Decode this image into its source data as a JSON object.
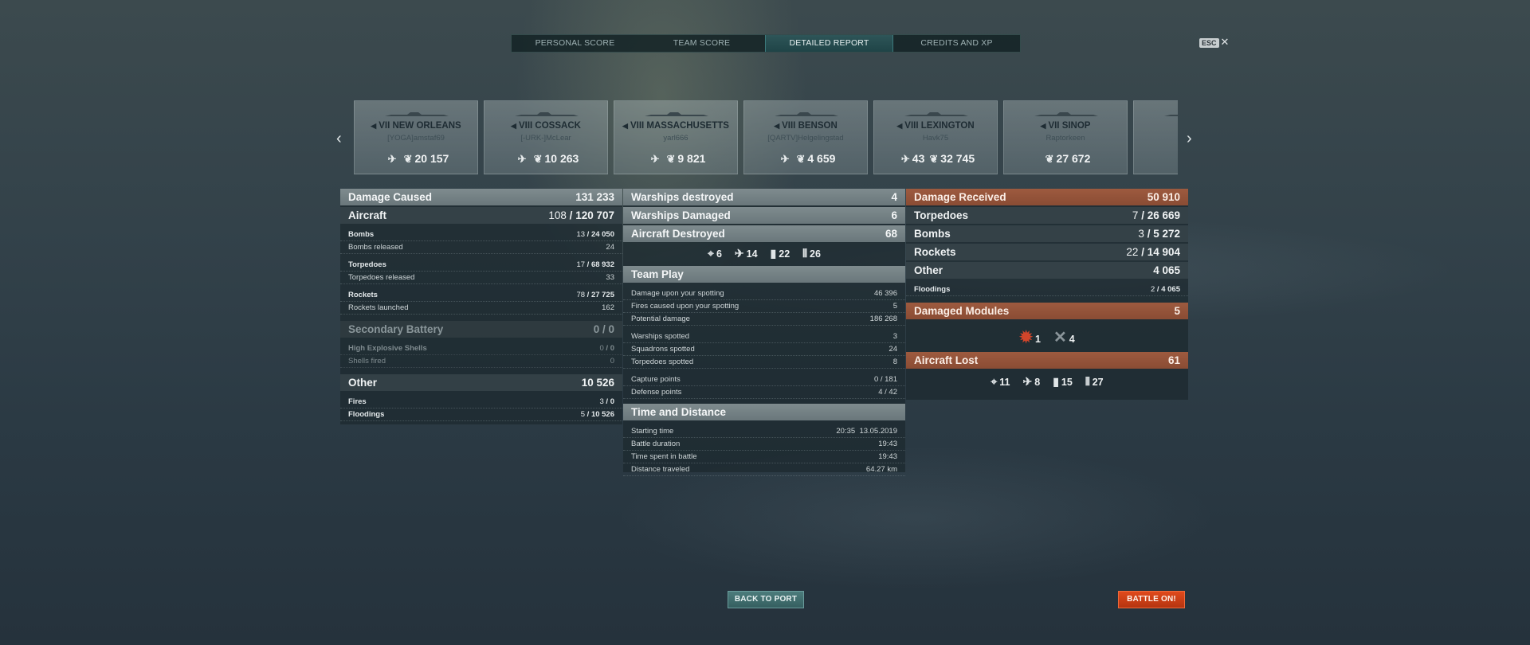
{
  "tabs": [
    "PERSONAL SCORE",
    "TEAM SCORE",
    "DETAILED REPORT",
    "CREDITS AND XP"
  ],
  "active_tab": "DETAILED REPORT",
  "esc": {
    "key": "ESC",
    "close": "✕"
  },
  "nav": {
    "prev": "‹",
    "next": "›"
  },
  "ships": [
    {
      "tier_name": "VII NEW ORLEANS",
      "player": "[YOGA]amstaf69",
      "icons": [
        "plane-icon",
        "laurel-icon"
      ],
      "values": [
        "",
        "20 157"
      ]
    },
    {
      "tier_name": "VIII COSSACK",
      "player": "[-URK-]McLear",
      "icons": [
        "plane-icon",
        "laurel-icon"
      ],
      "values": [
        "",
        "10 263"
      ]
    },
    {
      "tier_name": "VIII MASSACHUSETTS",
      "player": "yarl666",
      "icons": [
        "plane-icon",
        "laurel-icon"
      ],
      "values": [
        "",
        "9 821"
      ]
    },
    {
      "tier_name": "VIII BENSON",
      "player": "[QARTV]Helgelingstad",
      "icons": [
        "plane-icon",
        "laurel-icon"
      ],
      "values": [
        "",
        "4 659"
      ]
    },
    {
      "tier_name": "VIII LEXINGTON",
      "player": "Havk75",
      "icons": [
        "crossed-plane-icon",
        "laurel-icon"
      ],
      "values": [
        "43",
        "32 745"
      ]
    },
    {
      "tier_name": "VII SINOP",
      "player": "Raptorkeen",
      "icons": [
        "laurel-icon"
      ],
      "values": [
        "27 672"
      ]
    },
    {
      "tier_name": "V",
      "player": "[BA",
      "icons": [],
      "values": []
    }
  ],
  "damage_caused": {
    "header": {
      "label": "Damage Caused",
      "value": "131 233"
    },
    "aircraft": {
      "label": "Aircraft",
      "value_a": "108",
      "value_b": "120 707"
    },
    "bombs": {
      "label": "Bombs",
      "value_a": "13",
      "value_b": "24 050"
    },
    "bombs_released": {
      "label": "Bombs released",
      "value": "24"
    },
    "torpedoes": {
      "label": "Torpedoes",
      "value_a": "17",
      "value_b": "68 932"
    },
    "torpedoes_released": {
      "label": "Torpedoes released",
      "value": "33"
    },
    "rockets": {
      "label": "Rockets",
      "value_a": "78",
      "value_b": "27 725"
    },
    "rockets_launched": {
      "label": "Rockets launched",
      "value": "162"
    },
    "secondary": {
      "label": "Secondary Battery",
      "value": "0 / 0"
    },
    "he_shells": {
      "label": "High Explosive Shells",
      "value_a": "0",
      "value_b": "0"
    },
    "shells_fired": {
      "label": "Shells fired",
      "value": "0"
    },
    "other": {
      "label": "Other",
      "value": "10 526"
    },
    "fires": {
      "label": "Fires",
      "value_a": "3",
      "value_b": "0"
    },
    "floodings": {
      "label": "Floodings",
      "value_a": "5",
      "value_b": "10 526"
    }
  },
  "middle": {
    "warships_destroyed": {
      "label": "Warships destroyed",
      "value": "4"
    },
    "warships_damaged": {
      "label": "Warships Damaged",
      "value": "6"
    },
    "aircraft_destroyed": {
      "label": "Aircraft Destroyed",
      "value": "68"
    },
    "aircraft_icons": [
      {
        "icon": "crosshair-icon",
        "value": "6"
      },
      {
        "icon": "crossed-plane-icon",
        "value": "14"
      },
      {
        "icon": "bomb-icon",
        "value": "22"
      },
      {
        "icon": "rockets-icon",
        "value": "26"
      }
    ],
    "team_play": {
      "title": "Team Play",
      "rows": [
        {
          "label": "Damage upon your spotting",
          "value": "46 396"
        },
        {
          "label": "Fires caused upon your spotting",
          "value": "5"
        },
        {
          "label": "Potential damage",
          "value": "186 268"
        },
        {
          "label": "Warships spotted",
          "value": "3"
        },
        {
          "label": "Squadrons spotted",
          "value": "24"
        },
        {
          "label": "Torpedoes spotted",
          "value": "8"
        },
        {
          "label": "Capture points",
          "value": "0 / 181"
        },
        {
          "label": "Defense points",
          "value": "4 / 42"
        }
      ]
    },
    "time_distance": {
      "title": "Time and Distance",
      "rows": [
        {
          "label": "Starting time",
          "value": "20:35  13.05.2019"
        },
        {
          "label": "Battle duration",
          "value": "19:43"
        },
        {
          "label": "Time spent in battle",
          "value": "19:43"
        },
        {
          "label": "Distance traveled",
          "value": "64.27 km"
        }
      ]
    }
  },
  "damage_received": {
    "header": {
      "label": "Damage Received",
      "value": "50 910"
    },
    "torpedoes": {
      "label": "Torpedoes",
      "value_a": "7",
      "value_b": "26 669"
    },
    "bombs": {
      "label": "Bombs",
      "value_a": "3",
      "value_b": "5 272"
    },
    "rockets": {
      "label": "Rockets",
      "value_a": "22",
      "value_b": "14 904"
    },
    "other": {
      "label": "Other",
      "value": "4 065"
    },
    "floodings": {
      "label": "Floodings",
      "value_a": "2",
      "value_b": "4 065"
    },
    "modules": {
      "label": "Damaged Modules",
      "value": "5"
    },
    "module_icons": [
      {
        "icon": "engine-damage-icon",
        "value": "1",
        "color": "#d2452a"
      },
      {
        "icon": "aa-gun-icon",
        "value": "4",
        "color": "#8a959a"
      }
    ],
    "aircraft_lost": {
      "label": "Aircraft Lost",
      "value": "61"
    },
    "lost_icons": [
      {
        "icon": "crosshair-icon",
        "value": "11"
      },
      {
        "icon": "crossed-plane-icon",
        "value": "8"
      },
      {
        "icon": "bomb-icon",
        "value": "15"
      },
      {
        "icon": "rockets-icon",
        "value": "27"
      }
    ]
  },
  "buttons": {
    "back": "BACK TO PORT",
    "battle": "BATTLE ON!"
  },
  "colors": {
    "accent_teal": "#2e5558",
    "orange_header": "#9d5a3f",
    "battle_button": "#e04a1c"
  }
}
